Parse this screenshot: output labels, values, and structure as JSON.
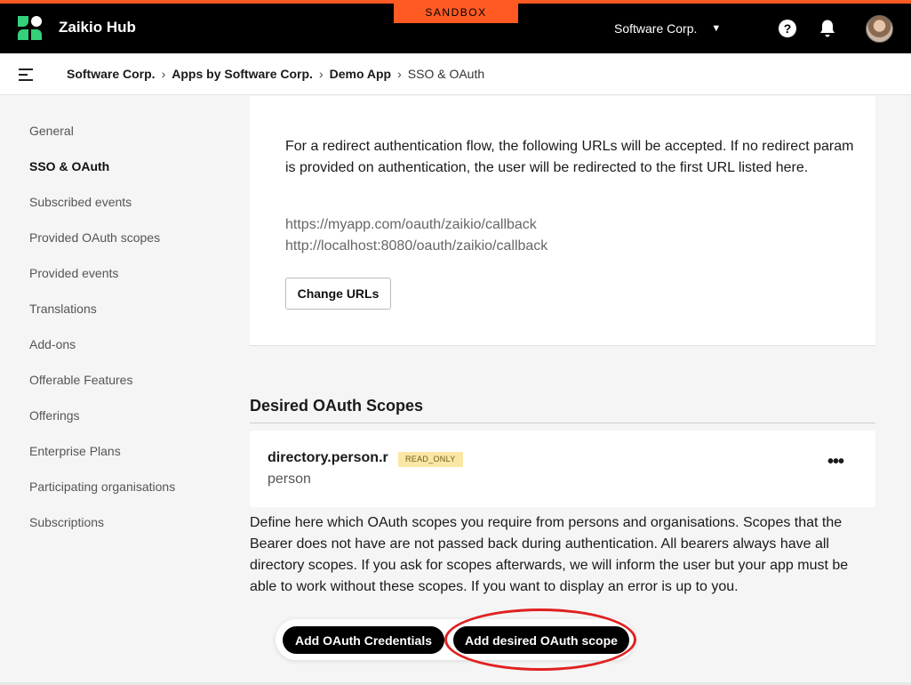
{
  "topbar": {
    "app_name": "Zaikio Hub",
    "env_badge": "SANDBOX",
    "org_name": "Software Corp.",
    "org_caret": "▼",
    "help_glyph": "?",
    "accent_color": "#ff5a23",
    "brand_color": "#34d17a"
  },
  "breadcrumb": {
    "items": [
      "Software Corp.",
      "Apps by Software Corp.",
      "Demo App"
    ],
    "current": "SSO & OAuth",
    "separator": "›"
  },
  "sidebar": {
    "items": [
      {
        "label": "General"
      },
      {
        "label": "SSO & OAuth"
      },
      {
        "label": "Subscribed events"
      },
      {
        "label": "Provided OAuth scopes"
      },
      {
        "label": "Provided events"
      },
      {
        "label": "Translations"
      },
      {
        "label": "Add-ons"
      },
      {
        "label": "Offerable Features"
      },
      {
        "label": "Offerings"
      },
      {
        "label": "Enterprise Plans"
      },
      {
        "label": "Participating organisations"
      },
      {
        "label": "Subscriptions"
      }
    ],
    "active": "SSO & OAuth"
  },
  "redirect": {
    "description": "For a redirect authentication flow, the following URLs will be accepted. If no redirect param is provided on authentication, the user will be redirected to the first URL listed here.",
    "urls": [
      "https://myapp.com/oauth/zaikio/callback",
      "http://localhost:8080/oauth/zaikio/callback"
    ],
    "change_button": "Change URLs"
  },
  "scopes": {
    "title": "Desired OAuth Scopes",
    "items": [
      {
        "name": "directory.person.r",
        "badge": "READ_ONLY",
        "subtitle": "person",
        "more": "•••"
      }
    ],
    "help_text": "Define here which OAuth scopes you require from persons and organisations. Scopes that the Bearer does not have are not passed back during authentication. All bearers always have all directory scopes. If you ask for scopes afterwards, we will inform the user but your app must be able to work without these scopes. If you want to display an error is up to you."
  },
  "actions": {
    "add_credentials": "Add OAuth Credentials",
    "add_scope": "Add desired OAuth scope",
    "highlight_color": "#e02020"
  }
}
